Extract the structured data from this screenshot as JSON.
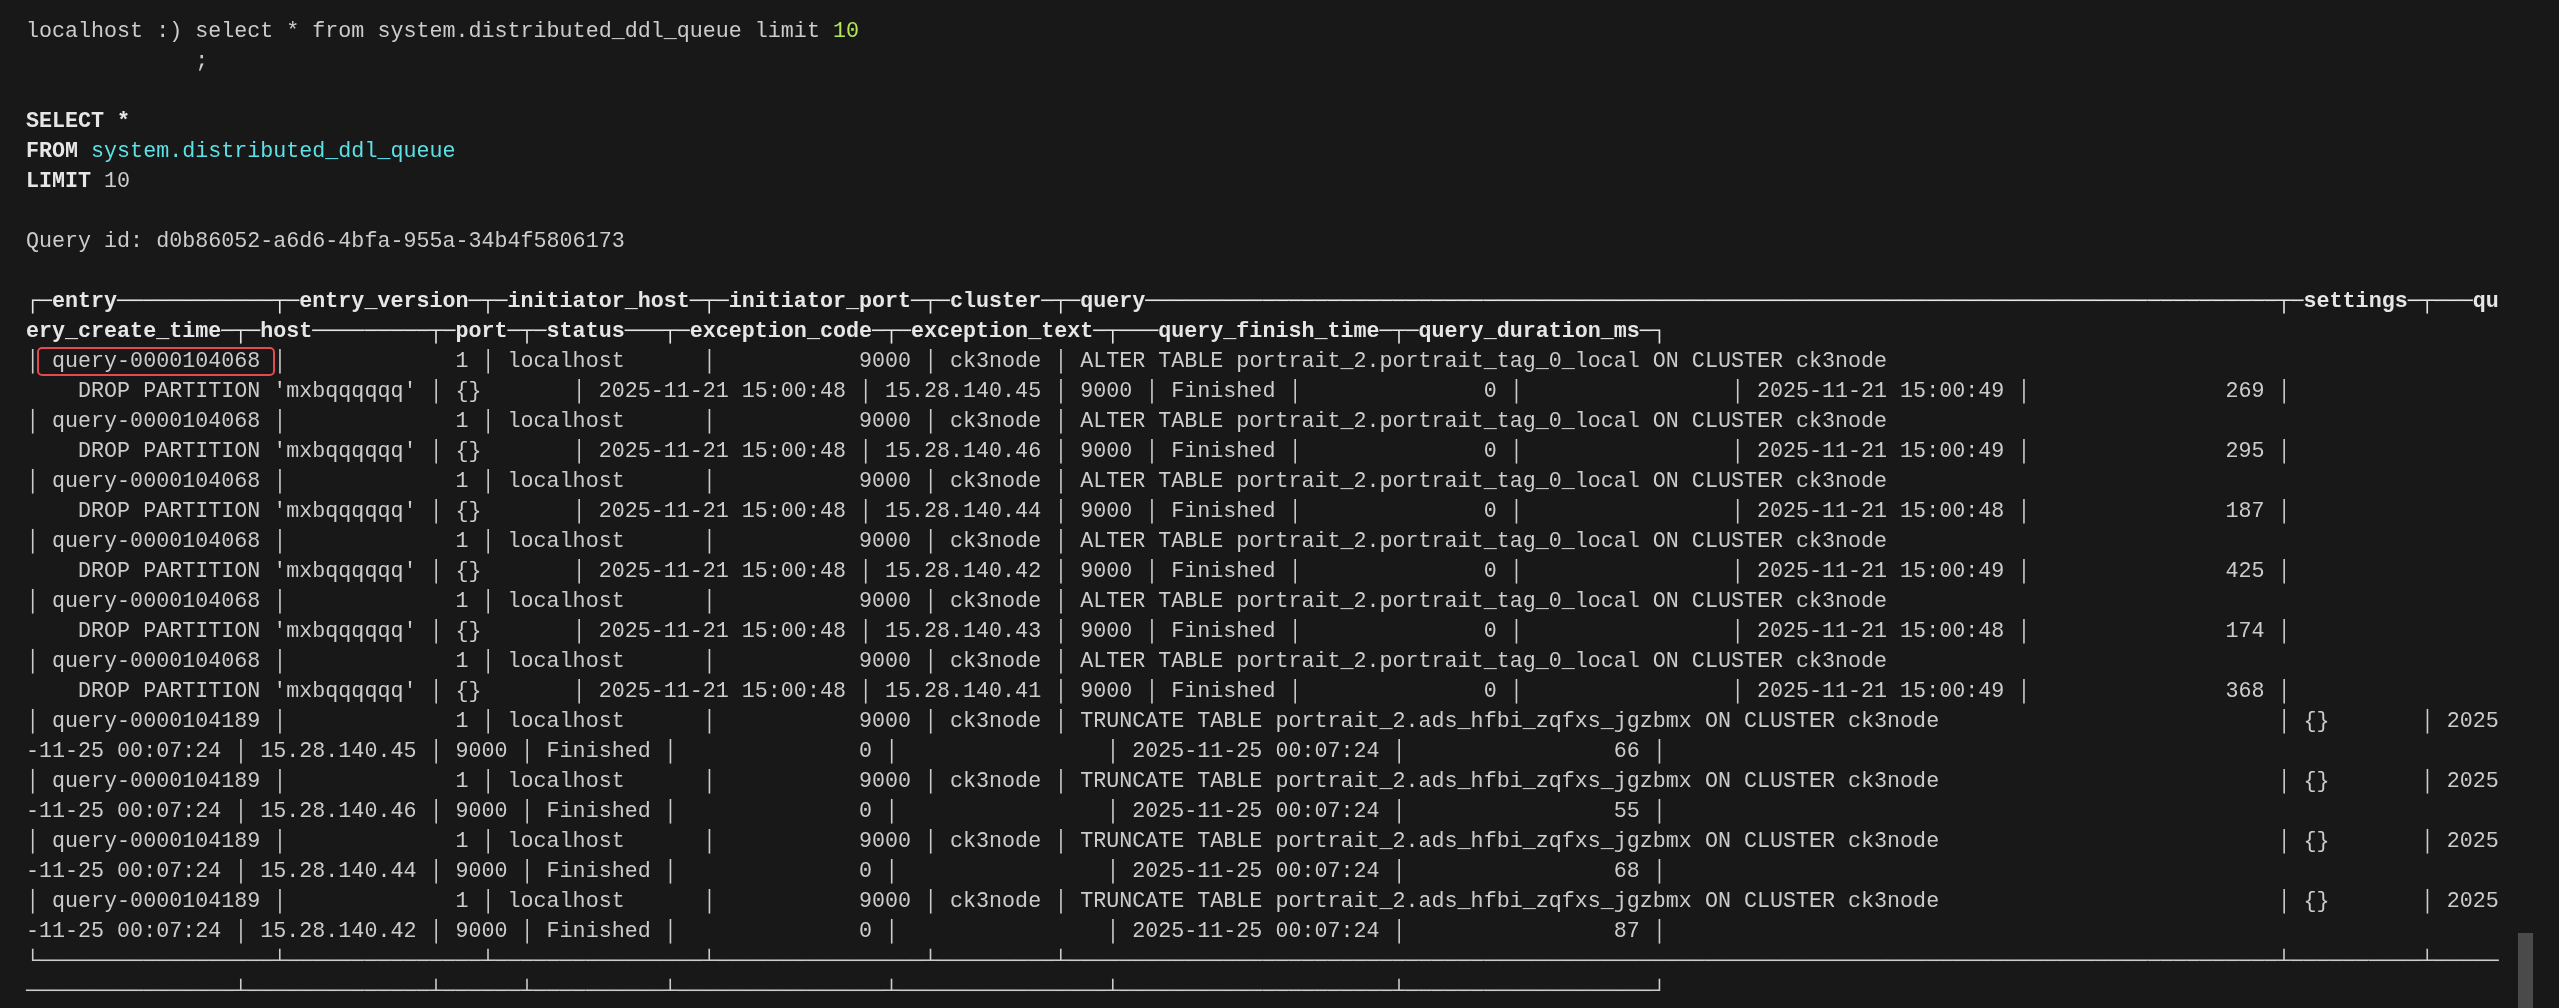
{
  "blocks": [
    {
      "lines": [
        [
          {
            "kind": "text",
            "text": "localhost :) select * from system.distributed_ddl_queue limit "
          },
          {
            "kind": "number",
            "text": "10"
          }
        ],
        [
          {
            "kind": "text",
            "text": "             ;"
          }
        ]
      ]
    },
    {
      "lines": [
        [
          {
            "kind": "keyword",
            "text": "SELECT *"
          }
        ],
        [
          {
            "kind": "keyword",
            "text": "FROM "
          },
          {
            "kind": "identifier",
            "text": "system.distributed_ddl_queue"
          }
        ],
        [
          {
            "kind": "keyword",
            "text": "LIMIT"
          },
          {
            "kind": "text",
            "text": " 10"
          }
        ]
      ]
    },
    {
      "lines": [
        [
          {
            "kind": "text",
            "text": "Query id: d0b86052-a6d6-4bfa-955a-34b4f5806173"
          }
        ]
      ]
    },
    {
      "lines": [
        [
          {
            "kind": "header",
            "text": "┌─entry────────────┬─entry_version─┬─initiator_host─┬─initiator_port─┬─cluster─┬─query───────────────────────────────────────────────────────────────────────────────────────┬─settings─┬───qu"
          }
        ],
        [
          {
            "kind": "header",
            "text": "ery_create_time─┬─host─────────┬─port─┬─status───┬─exception_code─┬─exception_text─┬───query_finish_time─┬─query_duration_ms─┐"
          }
        ],
        [
          {
            "kind": "text",
            "text": "│"
          },
          {
            "kind": "highlighted",
            "text": " query-0000104068 "
          },
          {
            "kind": "text",
            "text": "│             1 │ localhost      │           9000 │ ck3node │ ALTER TABLE portrait_2.portrait_tag_0_local ON CLUSTER ck3node"
          }
        ],
        [
          {
            "kind": "text",
            "text": "    DROP PARTITION 'mxbqqqqqq' │ {}       │ 2025-11-21 15:00:48 │ 15.28.140.45 │ 9000 │ Finished │              0 │                │ 2025-11-21 15:00:49 │               269 │"
          }
        ],
        [
          {
            "kind": "text",
            "text": "│ query-0000104068 │             1 │ localhost      │           9000 │ ck3node │ ALTER TABLE portrait_2.portrait_tag_0_local ON CLUSTER ck3node"
          }
        ],
        [
          {
            "kind": "text",
            "text": "    DROP PARTITION 'mxbqqqqqq' │ {}       │ 2025-11-21 15:00:48 │ 15.28.140.46 │ 9000 │ Finished │              0 │                │ 2025-11-21 15:00:49 │               295 │"
          }
        ],
        [
          {
            "kind": "text",
            "text": "│ query-0000104068 │             1 │ localhost      │           9000 │ ck3node │ ALTER TABLE portrait_2.portrait_tag_0_local ON CLUSTER ck3node"
          }
        ],
        [
          {
            "kind": "text",
            "text": "    DROP PARTITION 'mxbqqqqqq' │ {}       │ 2025-11-21 15:00:48 │ 15.28.140.44 │ 9000 │ Finished │              0 │                │ 2025-11-21 15:00:48 │               187 │"
          }
        ],
        [
          {
            "kind": "text",
            "text": "│ query-0000104068 │             1 │ localhost      │           9000 │ ck3node │ ALTER TABLE portrait_2.portrait_tag_0_local ON CLUSTER ck3node"
          }
        ],
        [
          {
            "kind": "text",
            "text": "    DROP PARTITION 'mxbqqqqqq' │ {}       │ 2025-11-21 15:00:48 │ 15.28.140.42 │ 9000 │ Finished │              0 │                │ 2025-11-21 15:00:49 │               425 │"
          }
        ],
        [
          {
            "kind": "text",
            "text": "│ query-0000104068 │             1 │ localhost      │           9000 │ ck3node │ ALTER TABLE portrait_2.portrait_tag_0_local ON CLUSTER ck3node"
          }
        ],
        [
          {
            "kind": "text",
            "text": "    DROP PARTITION 'mxbqqqqqq' │ {}       │ 2025-11-21 15:00:48 │ 15.28.140.43 │ 9000 │ Finished │              0 │                │ 2025-11-21 15:00:48 │               174 │"
          }
        ],
        [
          {
            "kind": "text",
            "text": "│ query-0000104068 │             1 │ localhost      │           9000 │ ck3node │ ALTER TABLE portrait_2.portrait_tag_0_local ON CLUSTER ck3node"
          }
        ],
        [
          {
            "kind": "text",
            "text": "    DROP PARTITION 'mxbqqqqqq' │ {}       │ 2025-11-21 15:00:48 │ 15.28.140.41 │ 9000 │ Finished │              0 │                │ 2025-11-21 15:00:49 │               368 │"
          }
        ],
        [
          {
            "kind": "text",
            "text": "│ query-0000104189 │             1 │ localhost      │           9000 │ ck3node │ TRUNCATE TABLE portrait_2.ads_hfbi_zqfxs_jgzbmx ON CLUSTER ck3node                          │ {}       │ 2025"
          }
        ],
        [
          {
            "kind": "text",
            "text": "-11-25 00:07:24 │ 15.28.140.45 │ 9000 │ Finished │              0 │                │ 2025-11-25 00:07:24 │                66 │"
          }
        ],
        [
          {
            "kind": "text",
            "text": "│ query-0000104189 │             1 │ localhost      │           9000 │ ck3node │ TRUNCATE TABLE portrait_2.ads_hfbi_zqfxs_jgzbmx ON CLUSTER ck3node                          │ {}       │ 2025"
          }
        ],
        [
          {
            "kind": "text",
            "text": "-11-25 00:07:24 │ 15.28.140.46 │ 9000 │ Finished │              0 │                │ 2025-11-25 00:07:24 │                55 │"
          }
        ],
        [
          {
            "kind": "text",
            "text": "│ query-0000104189 │             1 │ localhost      │           9000 │ ck3node │ TRUNCATE TABLE portrait_2.ads_hfbi_zqfxs_jgzbmx ON CLUSTER ck3node                          │ {}       │ 2025"
          }
        ],
        [
          {
            "kind": "text",
            "text": "-11-25 00:07:24 │ 15.28.140.44 │ 9000 │ Finished │              0 │                │ 2025-11-25 00:07:24 │                68 │"
          }
        ],
        [
          {
            "kind": "text",
            "text": "│ query-0000104189 │             1 │ localhost      │           9000 │ ck3node │ TRUNCATE TABLE portrait_2.ads_hfbi_zqfxs_jgzbmx ON CLUSTER ck3node                          │ {}       │ 2025"
          }
        ],
        [
          {
            "kind": "text",
            "text": "-11-25 00:07:24 │ 15.28.140.42 │ 9000 │ Finished │              0 │                │ 2025-11-25 00:07:24 │                87 │"
          }
        ],
        [
          {
            "kind": "text",
            "text": "└──────────────────┴───────────────┴────────────────┴────────────────┴─────────┴─────────────────────────────────────────────────────────────────────────────────────────────┴──────────┴─────"
          }
        ],
        [
          {
            "kind": "text",
            "text": "────────────────┴──────────────┴──────┴──────────┴────────────────┴────────────────┴─────────────────────┴───────────────────┘"
          }
        ]
      ]
    }
  ]
}
